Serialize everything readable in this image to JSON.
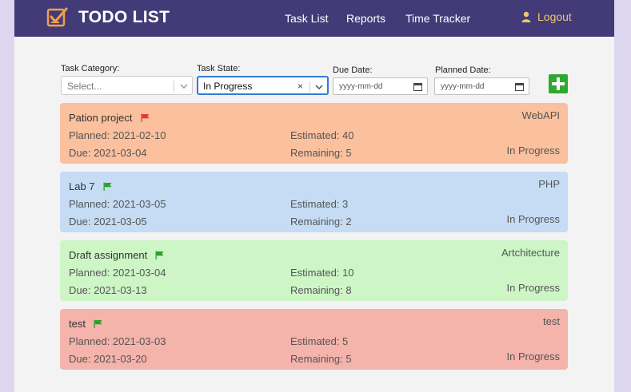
{
  "nav": {
    "brand": "TODO LIST",
    "links": [
      "Task List",
      "Reports",
      "Time Tracker"
    ],
    "logout": "Logout"
  },
  "filters": {
    "category_label": "Task Category:",
    "category_placeholder": "Select...",
    "state_label": "Task State:",
    "state_value": "In Progress",
    "clear_glyph": "×",
    "due_label": "Due Date:",
    "due_placeholder": "yyyy-mm-dd",
    "planned_label": "Planned Date:",
    "planned_placeholder": "yyyy-mm-dd"
  },
  "colors": {
    "navbar": "#433b78",
    "accent_logout": "#f0c66f",
    "add_button": "#2fa82f",
    "flag_red": "#e53935",
    "flag_green": "#2e9e2e"
  },
  "tasks": [
    {
      "title": "Pation project",
      "flag_color": "#e53935",
      "category": "WebAPI",
      "planned": "Planned: 2021-02-10",
      "due": "Due: 2021-03-04",
      "estimated": "Estimated: 40",
      "remaining": "Remaining: 5",
      "state": "In Progress",
      "bg": "#fbc09d"
    },
    {
      "title": "Lab 7",
      "flag_color": "#2e9e2e",
      "category": "PHP",
      "planned": "Planned: 2021-03-05",
      "due": "Due: 2021-03-05",
      "estimated": "Estimated: 3",
      "remaining": "Remaining: 2",
      "state": "In Progress",
      "bg": "#c5dcf4"
    },
    {
      "title": "Draft assignment",
      "flag_color": "#2e9e2e",
      "category": "Artchitecture",
      "planned": "Planned: 2021-03-04",
      "due": "Due: 2021-03-13",
      "estimated": "Estimated: 10",
      "remaining": "Remaining: 8",
      "state": "In Progress",
      "bg": "#cdf5c6"
    },
    {
      "title": "test",
      "flag_color": "#2e9e2e",
      "category": "test",
      "planned": "Planned: 2021-03-03",
      "due": "Due: 2021-03-20",
      "estimated": "Estimated: 5",
      "remaining": "Remaining: 5",
      "state": "In Progress",
      "bg": "#f4b3ab"
    }
  ]
}
